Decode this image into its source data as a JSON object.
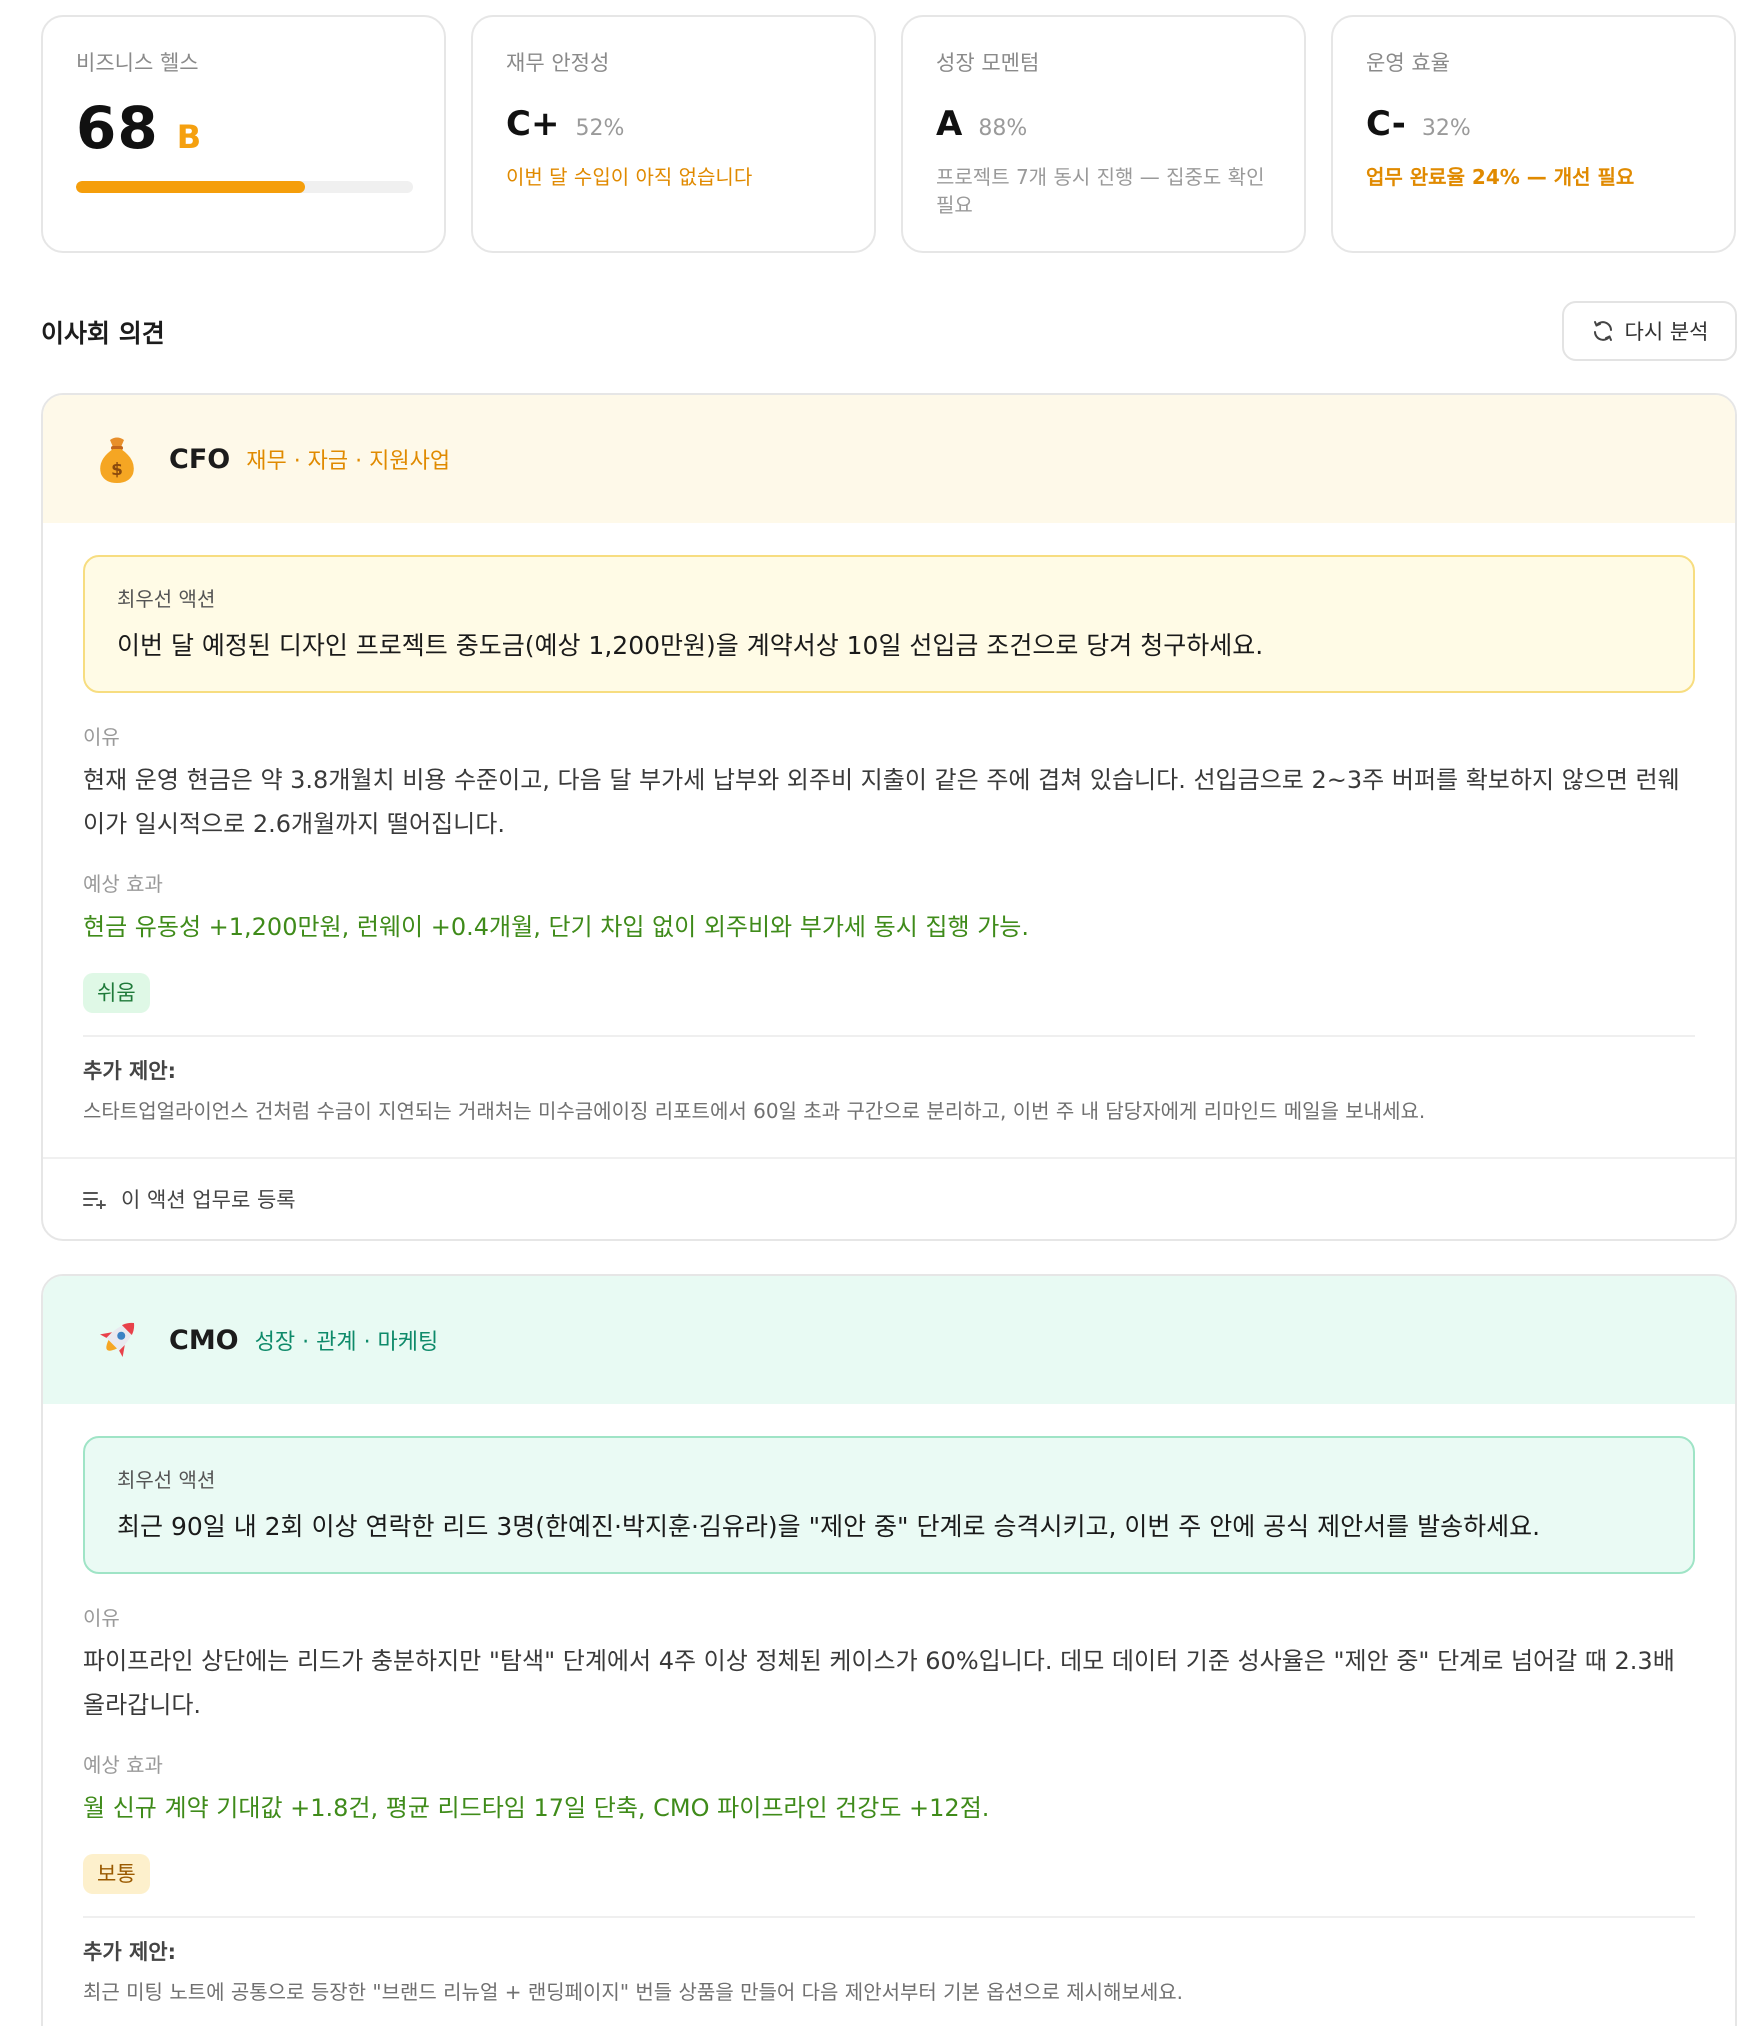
{
  "metrics": {
    "health": {
      "label": "비즈니스 헬스",
      "score": "68",
      "grade": "B",
      "progress": 0.68
    },
    "finance": {
      "label": "재무 안정성",
      "grade": "C+",
      "pct": "52%",
      "note": "이번 달 수입이 아직 없습니다"
    },
    "growth": {
      "label": "성장 모멘텀",
      "grade": "A",
      "pct": "88%",
      "note": "프로젝트 7개 동시 진행 — 집중도 확인 필요"
    },
    "ops": {
      "label": "운영 효율",
      "grade": "C-",
      "pct": "32%",
      "note": "업무 완료율 24% — 개선 필요"
    }
  },
  "section": {
    "title": "이사회 의견",
    "reanalyze_label": "다시 분석"
  },
  "advisors": {
    "cfo": {
      "role": "CFO",
      "tags": "재무 · 자금 · 지원사업",
      "priority_label": "최우선 액션",
      "priority_text": "이번 달 예정된 디자인 프로젝트 중도금(예상 1,200만원)을 계약서상 10일 선입금 조건으로 당겨 청구하세요.",
      "reason_label": "이유",
      "reason_text": "현재 운영 현금은 약 3.8개월치 비용 수준이고, 다음 달 부가세 납부와 외주비 지출이 같은 주에 겹쳐 있습니다. 선입금으로 2~3주 버퍼를 확보하지 않으면 런웨이가 일시적으로 2.6개월까지 떨어집니다.",
      "effect_label": "예상 효과",
      "effect_text": "현금 유동성 +1,200만원, 런웨이 +0.4개월, 단기 차입 없이 외주비와 부가세 동시 집행 가능.",
      "difficulty": "쉬움",
      "extra_label": "추가 제안:",
      "extra_text": "스타트업얼라이언스 건처럼 수금이 지연되는 거래처는 미수금에이징 리포트에서 60일 초과 구간으로 분리하고, 이번 주 내 담당자에게 리마인드 메일을 보내세요.",
      "footer_label": "이 액션 업무로 등록"
    },
    "cmo": {
      "role": "CMO",
      "tags": "성장 · 관계 · 마케팅",
      "priority_label": "최우선 액션",
      "priority_text": "최근 90일 내 2회 이상 연락한 리드 3명(한예진·박지훈·김유라)을 \"제안 중\" 단계로 승격시키고, 이번 주 안에 공식 제안서를 발송하세요.",
      "reason_label": "이유",
      "reason_text": "파이프라인 상단에는 리드가 충분하지만 \"탐색\" 단계에서 4주 이상 정체된 케이스가 60%입니다. 데모 데이터 기준 성사율은 \"제안 중\" 단계로 넘어갈 때 2.3배 올라갑니다.",
      "effect_label": "예상 효과",
      "effect_text": "월 신규 계약 기대값 +1.8건, 평균 리드타임 17일 단축, CMO 파이프라인 건강도 +12점.",
      "difficulty": "보통",
      "extra_label": "추가 제안:",
      "extra_text": "최근 미팅 노트에 공통으로 등장한 \"브랜드 리뉴얼 + 랜딩페이지\" 번들 상품을 만들어 다음 제안서부터 기본 옵션으로 제시해보세요."
    }
  },
  "colors": {
    "accent_orange": "#f59e0b",
    "cfo_bg": "#fef9e9",
    "cmo_bg": "#e8faf3",
    "effect_green": "#3f8b1a"
  },
  "icons": {
    "reanalyze": "refresh-icon",
    "cfo": "money-bag-icon",
    "cmo": "rocket-icon",
    "register": "list-add-icon"
  }
}
